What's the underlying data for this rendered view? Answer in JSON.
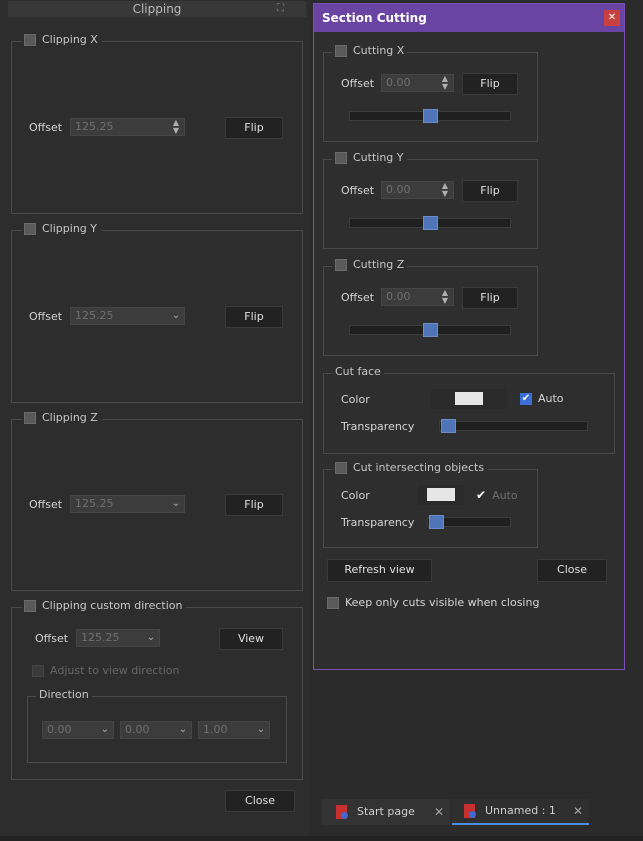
{
  "left_panel": {
    "title": "Clipping",
    "clip_x": {
      "label": "Clipping X",
      "offset_label": "Offset",
      "offset_value": "125.25",
      "flip_label": "Flip"
    },
    "clip_y": {
      "label": "Clipping Y",
      "offset_label": "Offset",
      "offset_value": "125.25",
      "flip_label": "Flip"
    },
    "clip_z": {
      "label": "Clipping Z",
      "offset_label": "Offset",
      "offset_value": "125.25",
      "flip_label": "Flip"
    },
    "custom": {
      "label": "Clipping custom direction",
      "offset_label": "Offset",
      "offset_value": "125.25",
      "view_label": "View",
      "adjust_label": "Adjust to view direction",
      "direction_label": "Direction",
      "direction_values": [
        "0.00",
        "0.00",
        "1.00"
      ]
    },
    "close_label": "Close"
  },
  "dialog": {
    "title": "Section Cutting",
    "close_icon": "close-icon",
    "cut_x": {
      "label": "Cutting X",
      "offset_label": "Offset",
      "offset_value": "0.00",
      "flip_label": "Flip",
      "slider_fraction": 0.5
    },
    "cut_y": {
      "label": "Cutting Y",
      "offset_label": "Offset",
      "offset_value": "0.00",
      "flip_label": "Flip",
      "slider_fraction": 0.5
    },
    "cut_z": {
      "label": "Cutting Z",
      "offset_label": "Offset",
      "offset_value": "0.00",
      "flip_label": "Flip",
      "slider_fraction": 0.5
    },
    "cut_face": {
      "label": "Cut face",
      "color_label": "Color",
      "auto_label": "Auto",
      "auto_checked": true,
      "transparency_label": "Transparency",
      "transparency_fraction": 0.0
    },
    "cut_intersecting": {
      "label": "Cut intersecting objects",
      "color_label": "Color",
      "auto_label": "Auto",
      "transparency_label": "Transparency",
      "transparency_fraction": 0.0
    },
    "refresh_label": "Refresh view",
    "close_label": "Close",
    "keep_cuts_label": "Keep only cuts visible when closing"
  },
  "tabs": [
    {
      "label": "Start page",
      "icon": "project-icon",
      "active": false
    },
    {
      "label": "Unnamed : 1",
      "icon": "project-icon",
      "active": true
    }
  ],
  "colors": {
    "dialog_accent": "#6a44a3",
    "slider_thumb": "#4d75b8",
    "active_tab": "#4a8fe0",
    "close_red": "#c94040"
  }
}
